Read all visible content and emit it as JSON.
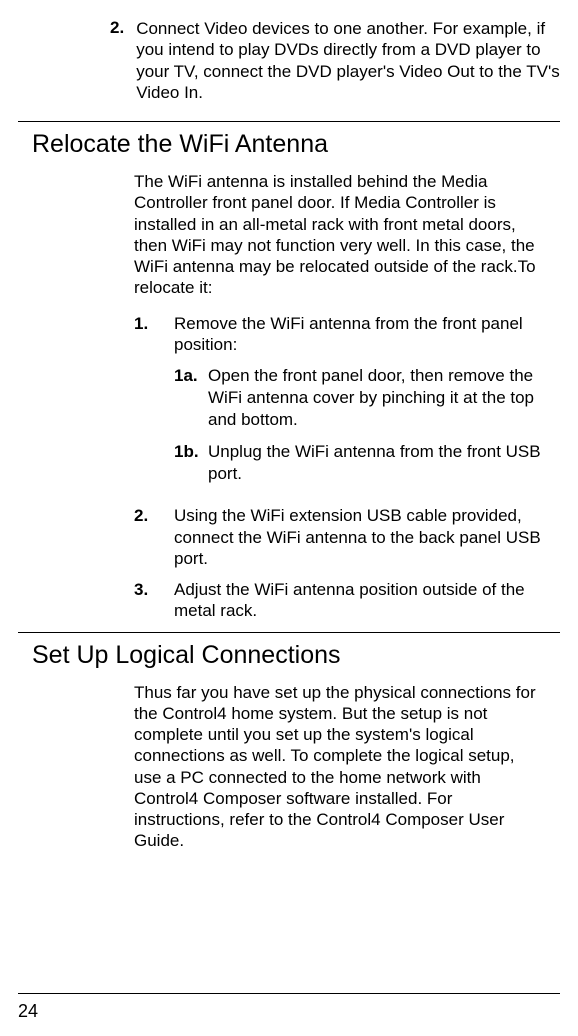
{
  "top_list": {
    "item2_num": "2.",
    "item2_text": "Connect Video devices to one another. For example, if you intend to play DVDs directly from a DVD player to your TV, connect the DVD player's Video Out to the TV's Video In."
  },
  "section_wifi": {
    "heading": "Relocate the WiFi Antenna",
    "intro": "The WiFi antenna is installed behind the Media Controller front panel door. If Media Controller is installed in an all-metal rack with front metal doors, then WiFi may not function very well. In this case, the WiFi antenna may be relocated outside of the rack.To relocate it:",
    "steps": [
      {
        "num": "1.",
        "text": "Remove the WiFi antenna from the front panel position:",
        "sub": [
          {
            "num": "1a.",
            "text": "Open the front panel door, then remove the WiFi antenna cover by pinching it at the top and bottom."
          },
          {
            "num": "1b.",
            "text": "Unplug the WiFi antenna from the front USB port."
          }
        ]
      },
      {
        "num": "2.",
        "text": "Using the WiFi extension USB cable provided, connect the WiFi antenna to the back panel USB port."
      },
      {
        "num": "3.",
        "text": "Adjust the WiFi antenna position outside of the metal rack."
      }
    ]
  },
  "section_logical": {
    "heading": "Set Up Logical Connections",
    "body": "Thus far you have set up the physical connections for the Control4 home system. But the setup is not complete until you set up the system's logical connections as well. To complete the logical setup, use a PC connected to the home network with Control4 Composer software installed. For instructions, refer to the Control4 Composer User Guide."
  },
  "page_number": "24"
}
